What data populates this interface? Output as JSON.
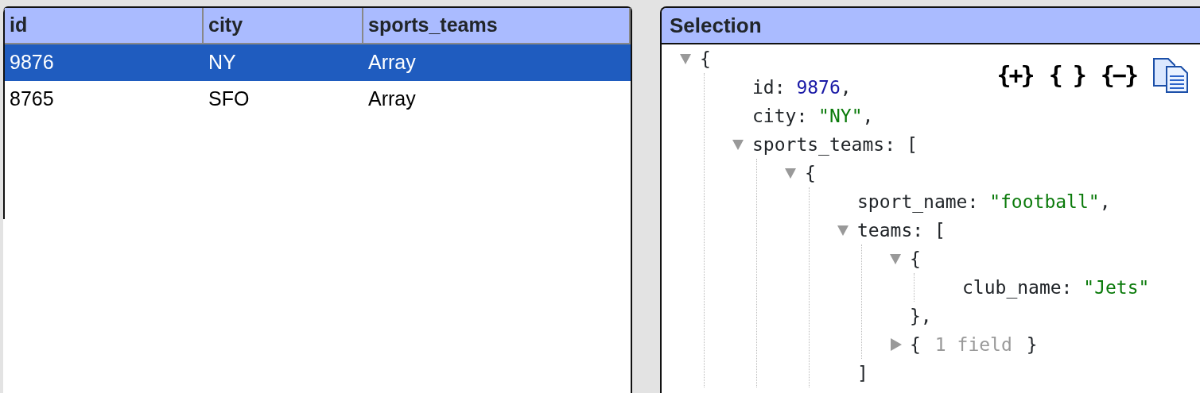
{
  "table": {
    "columns": [
      "id",
      "city",
      "sports_teams"
    ],
    "rows": [
      {
        "cells": [
          "9876",
          "NY",
          "Array"
        ],
        "selected": true
      },
      {
        "cells": [
          "8765",
          "SFO",
          "Array"
        ],
        "selected": false
      }
    ]
  },
  "selection_panel": {
    "title": "Selection",
    "toolbar": [
      {
        "kind": "expand",
        "label": "{+}"
      },
      {
        "kind": "braces",
        "label": "{ }"
      },
      {
        "kind": "collapse",
        "label": "{−}"
      },
      {
        "kind": "copy"
      }
    ],
    "tree": {
      "kind": "container",
      "open": "{",
      "expanded": true,
      "children": [
        {
          "kind": "number_field",
          "key": "id:",
          "value": "9876",
          "comma": ","
        },
        {
          "kind": "string_field",
          "key": "city:",
          "value": "\"NY\"",
          "comma": ","
        },
        {
          "kind": "container",
          "key": "sports_teams:",
          "open": "[",
          "expanded": true,
          "children": [
            {
              "kind": "container",
              "open": "{",
              "expanded": true,
              "children": [
                {
                  "kind": "string_field",
                  "key": "sport_name:",
                  "value": "\"football\"",
                  "comma": ","
                },
                {
                  "kind": "container",
                  "key": "teams:",
                  "open": "[",
                  "expanded": true,
                  "close": "]",
                  "children": [
                    {
                      "kind": "container",
                      "open": "{",
                      "expanded": true,
                      "close": "},",
                      "children": [
                        {
                          "kind": "string_field",
                          "key": "club_name:",
                          "value": "\"Jets\""
                        }
                      ]
                    },
                    {
                      "kind": "container",
                      "open": "{",
                      "expanded": false,
                      "summary": "1 field",
                      "close": "}"
                    }
                  ]
                }
              ]
            }
          ]
        }
      ]
    }
  }
}
